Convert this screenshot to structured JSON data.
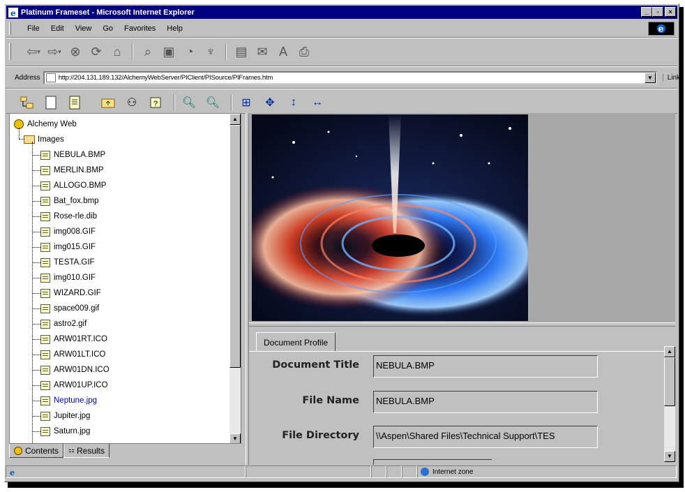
{
  "window": {
    "title": "Platinum Frameset - Microsoft Internet Explorer",
    "controls": {
      "minimize": "_",
      "maximize": "▫",
      "close": "×"
    }
  },
  "menu": [
    "File",
    "Edit",
    "View",
    "Go",
    "Favorites",
    "Help"
  ],
  "toolbar": {
    "buttons": [
      "back-icon",
      "forward-icon",
      "stop-icon",
      "refresh-icon",
      "home-icon",
      "search-icon",
      "favorites-icon",
      "history-icon",
      "channels-icon",
      "fullscreen-icon",
      "mail-icon",
      "font-icon",
      "print-icon"
    ]
  },
  "address": {
    "label": "Address",
    "url": "http://204.131.189.132/AlchemyWebServer/PIClient/PISource/PIFrames.htm",
    "links_label": "Links"
  },
  "app_toolbar": {
    "buttons": [
      "tree-view-icon",
      "document-icon",
      "properties-icon",
      "folder-up-icon",
      "binoculars-icon",
      "help-icon",
      "zoom-in-icon",
      "zoom-out-icon",
      "fit-page-icon",
      "pan-icon",
      "fit-height-icon",
      "fit-width-icon"
    ]
  },
  "tree": {
    "root": "Alchemy Web",
    "folder": "Images",
    "files": [
      "NEBULA.BMP",
      "MERLIN.BMP",
      "ALLOGO.BMP",
      "Bat_fox.bmp",
      "Rose-rle.dib",
      "img008.GIF",
      "img015.GIF",
      "TESTA.GIF",
      "img010.GIF",
      "WIZARD.GIF",
      "space009.gif",
      "astro2.gif",
      "ARW01RT.ICO",
      "ARW01LT.ICO",
      "ARW01DN.ICO",
      "ARW01UP.ICO",
      "Neptune.jpg",
      "Jupiter.jpg",
      "Saturn.jpg"
    ],
    "visited_index": 16
  },
  "left_tabs": {
    "contents": "Contents",
    "results": "Results"
  },
  "profile": {
    "tab": "Document Profile",
    "fields": [
      {
        "label": "Document Title",
        "value": "NEBULA.BMP"
      },
      {
        "label": "File Name",
        "value": "NEBULA.BMP"
      },
      {
        "label": "File Directory",
        "value": "\\\\Aspen\\Shared Files\\Technical Support\\TES"
      }
    ]
  },
  "status": {
    "zone": "Internet zone"
  },
  "colors": {
    "titlebar": "#000080",
    "chrome": "#c0c0c0",
    "link": "#0000c0"
  }
}
